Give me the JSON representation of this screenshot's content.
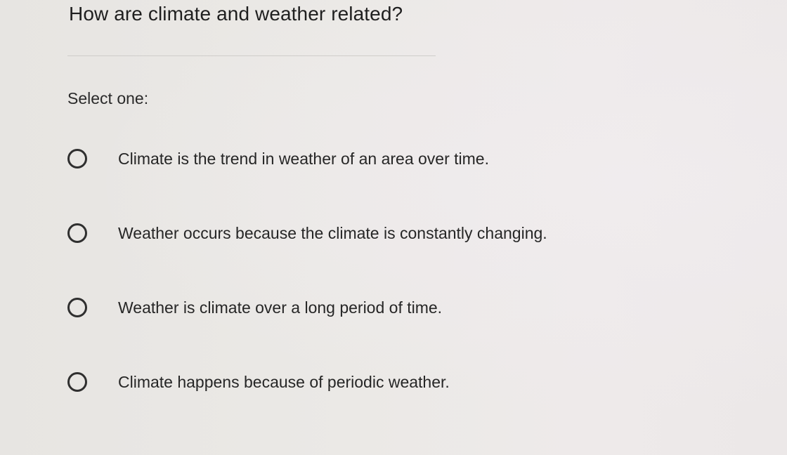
{
  "question": {
    "text": "How are climate and weather related?"
  },
  "prompt": "Select one:",
  "options": [
    {
      "label": "Climate is the trend in weather of an area over time.",
      "selected": false
    },
    {
      "label": "Weather occurs because the climate is constantly changing.",
      "selected": false
    },
    {
      "label": "Weather is climate over a long period of time.",
      "selected": false
    },
    {
      "label": "Climate happens because of periodic weather.",
      "selected": false
    }
  ],
  "colors": {
    "background": "#e9e7e4",
    "text": "#262626",
    "radio_border": "#2f2f2f",
    "divider": "#cfcdca"
  }
}
